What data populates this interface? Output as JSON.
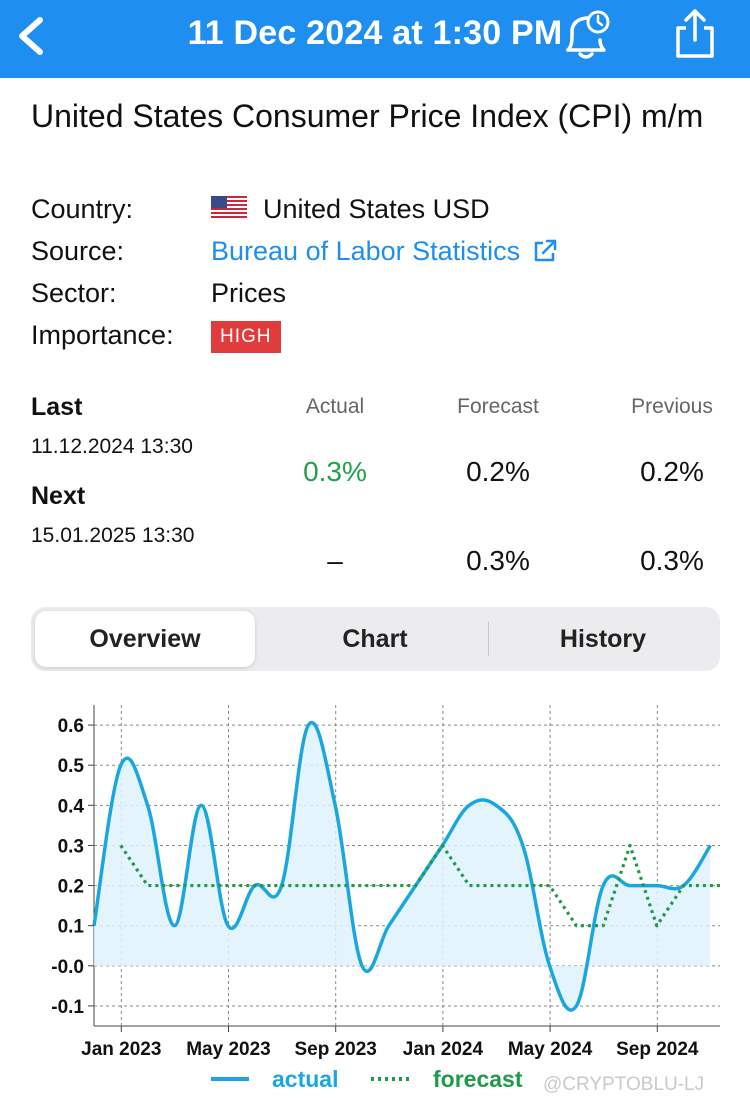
{
  "header": {
    "title": "11 Dec 2024 at 1:30 PM",
    "color": "#1f8ef1"
  },
  "event": {
    "title": "United States Consumer Price Index (CPI) m/m",
    "country_label": "Country:",
    "country_value": "United States USD",
    "source_label": "Source:",
    "source_value": "Bureau of Labor Statistics",
    "sector_label": "Sector:",
    "sector_value": "Prices",
    "importance_label": "Importance:",
    "importance_value": "HIGH"
  },
  "values": {
    "headers": {
      "actual": "Actual",
      "forecast": "Forecast",
      "previous": "Previous"
    },
    "last": {
      "label": "Last",
      "datetime": "11.12.2024 13:30",
      "actual": "0.3%",
      "forecast": "0.2%",
      "previous": "0.2%"
    },
    "next": {
      "label": "Next",
      "datetime": "15.01.2025 13:30",
      "actual": "–",
      "forecast": "0.3%",
      "previous": "0.3%"
    }
  },
  "tabs": [
    {
      "label": "Overview",
      "active": true
    },
    {
      "label": "Chart",
      "active": false
    },
    {
      "label": "History",
      "active": false
    }
  ],
  "chart_data": {
    "type": "line",
    "x": [
      "2023-01",
      "2023-02",
      "2023-03",
      "2023-04",
      "2023-05",
      "2023-06",
      "2023-07",
      "2023-08",
      "2023-09",
      "2023-10",
      "2023-11",
      "2023-12",
      "2024-01",
      "2024-02",
      "2024-03",
      "2024-04",
      "2024-05",
      "2024-06",
      "2024-07",
      "2024-08",
      "2024-09",
      "2024-10",
      "2024-11"
    ],
    "x_tick_labels": [
      "Jan 2023",
      "May 2023",
      "Sep 2023",
      "Jan 2024",
      "May 2024",
      "Sep 2024"
    ],
    "x_tick_index": [
      0,
      4,
      8,
      12,
      16,
      20
    ],
    "y_tick_labels": [
      "0.6",
      "0.5",
      "0.4",
      "0.3",
      "0.2",
      "0.1",
      "-0.0",
      "-0.1"
    ],
    "y_ticks": [
      0.6,
      0.5,
      0.4,
      0.3,
      0.2,
      0.1,
      0.0,
      -0.1
    ],
    "ylim": [
      -0.15,
      0.65
    ],
    "series": [
      {
        "name": "actual",
        "style": "solid",
        "color": "#1aa7e0",
        "values": [
          0.5,
          0.4,
          0.1,
          0.4,
          0.1,
          0.2,
          0.2,
          0.6,
          0.4,
          0.0,
          0.1,
          0.2,
          0.3,
          0.4,
          0.4,
          0.3,
          0.0,
          -0.1,
          0.2,
          0.2,
          0.2,
          0.2,
          0.3
        ]
      },
      {
        "name": "forecast",
        "style": "dotted",
        "color": "#1f9a4a",
        "values": [
          0.3,
          0.2,
          0.2,
          0.2,
          0.2,
          0.2,
          0.2,
          0.2,
          0.2,
          0.2,
          0.2,
          0.2,
          0.3,
          0.2,
          0.2,
          0.2,
          0.2,
          0.1,
          0.1,
          0.3,
          0.1,
          0.2,
          0.2
        ]
      }
    ],
    "grid": true,
    "legend": "bottom"
  },
  "watermark": "@CRYPTOBLU-LJ"
}
